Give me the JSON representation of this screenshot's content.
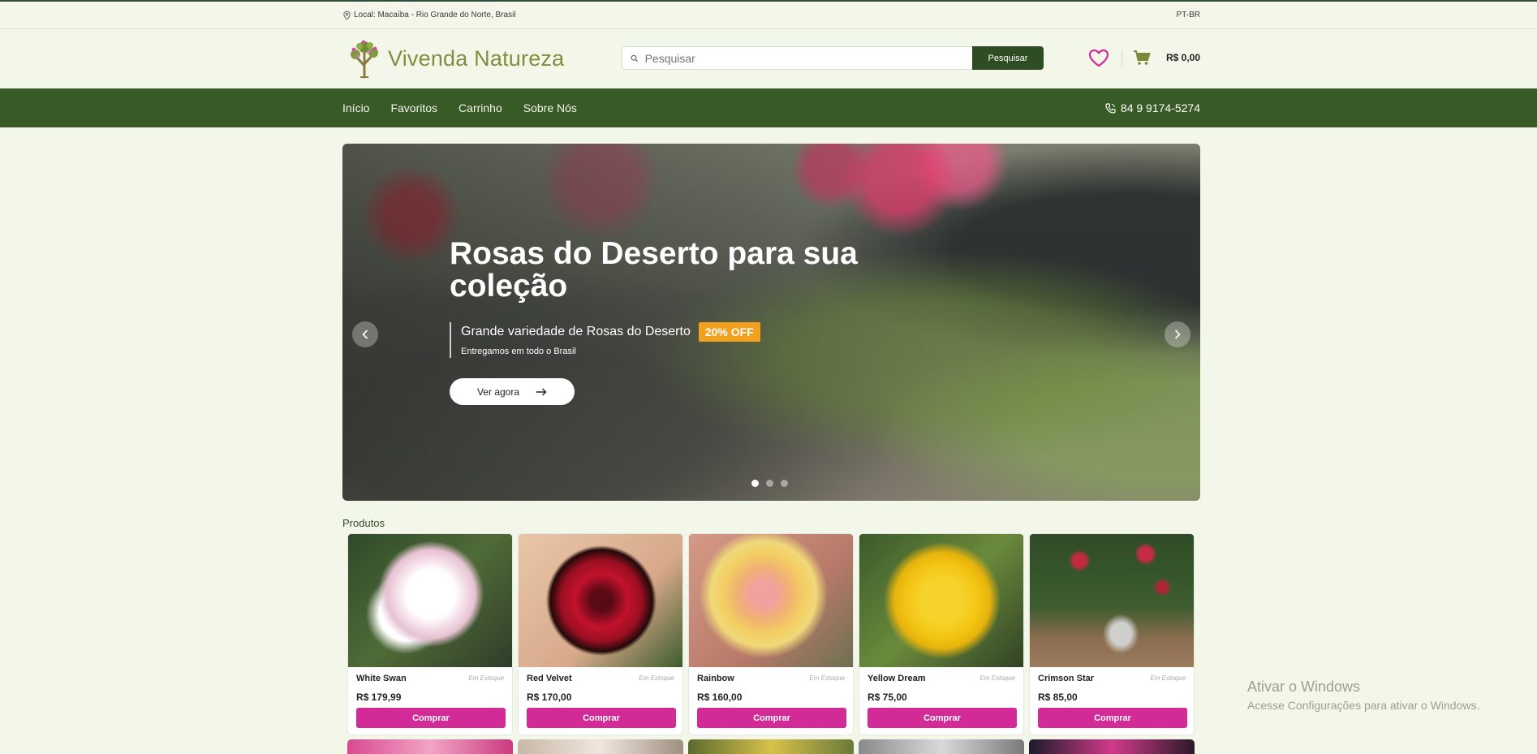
{
  "topbar": {
    "location": "Local: Macaíba - Rio Grande do Norte, Brasil",
    "language": "PT-BR"
  },
  "header": {
    "logo_text": "Vivenda Natureza",
    "search_placeholder": "Pesquisar",
    "search_button": "Pesquisar",
    "cart_total": "R$ 0,00"
  },
  "nav": {
    "items": [
      "Início",
      "Favoritos",
      "Carrinho",
      "Sobre Nós"
    ],
    "phone": "84 9 9174-5274"
  },
  "hero": {
    "title": "Rosas do Deserto para sua coleção",
    "subtitle": "Grande variedade de Rosas do Deserto",
    "badge": "20% OFF",
    "subtext": "Entregamos em todo o Brasil",
    "cta": "Ver agora",
    "active_slide": 1,
    "total_slides": 3
  },
  "products": {
    "section_title": "Produtos",
    "items": [
      {
        "name": "White Swan",
        "stock": "Em Estoque",
        "price": "R$ 179,99",
        "button": "Comprar"
      },
      {
        "name": "Red Velvet",
        "stock": "Em Estoque",
        "price": "R$ 170,00",
        "button": "Comprar"
      },
      {
        "name": "Rainbow",
        "stock": "Em Estoque",
        "price": "R$ 160,00",
        "button": "Comprar"
      },
      {
        "name": "Yellow Dream",
        "stock": "Em Estoque",
        "price": "R$ 75,00",
        "button": "Comprar"
      },
      {
        "name": "Crimson Star",
        "stock": "Em Estoque",
        "price": "R$ 85,00",
        "button": "Comprar"
      }
    ]
  },
  "watermark": {
    "line1": "Ativar o Windows",
    "line2": "Acesse Configurações para ativar o Windows."
  },
  "colors": {
    "brand_dark_green": "#385a26",
    "buy_pink": "#d22a97",
    "badge_orange": "#f2a11e",
    "logo_olive": "#7f8f3f"
  }
}
